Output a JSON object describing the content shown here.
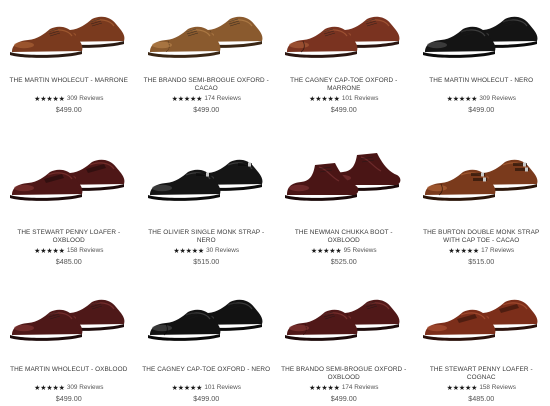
{
  "products": [
    {
      "name": "THE MARTIN WHOLECUT - MARRONE",
      "stars": "★★★★★",
      "reviews": "309 Reviews",
      "price": "$499.00",
      "style": "wholecut",
      "color": "#7a3a1e",
      "highlight": "#b46a3a",
      "sole": "#2a1a12"
    },
    {
      "name": "THE BRANDO SEMI-BROGUE OXFORD - CACAO",
      "stars": "★★★★★",
      "reviews": "174 Reviews",
      "price": "$499.00",
      "style": "brogue",
      "color": "#8a5a2e",
      "highlight": "#c08a52",
      "sole": "#3a2614"
    },
    {
      "name": "THE CAGNEY CAP-TOE OXFORD - MARRONE",
      "stars": "★★★★★",
      "reviews": "101 Reviews",
      "price": "$499.00",
      "style": "captoe",
      "color": "#7a3320",
      "highlight": "#b2643e",
      "sole": "#2a1510"
    },
    {
      "name": "THE MARTIN WHOLECUT - NERO",
      "stars": "★★★★★",
      "reviews": "309 Reviews",
      "price": "$499.00",
      "style": "wholecut",
      "color": "#141414",
      "highlight": "#5a5a5a",
      "sole": "#0a0a0a"
    },
    {
      "name": "THE STEWART PENNY LOAFER - OXBLOOD",
      "stars": "★★★★★",
      "reviews": "158 Reviews",
      "price": "$485.00",
      "style": "loafer",
      "color": "#4e1717",
      "highlight": "#8a3a36",
      "sole": "#1c0a0a"
    },
    {
      "name": "THE OLIVIER SINGLE MONK STRAP - NERO",
      "stars": "★★★★★",
      "reviews": "30 Reviews",
      "price": "$515.00",
      "style": "monk",
      "color": "#151515",
      "highlight": "#555555",
      "sole": "#0a0a0a"
    },
    {
      "name": "THE NEWMAN CHUKKA BOOT - OXBLOOD",
      "stars": "★★★★★",
      "reviews": "95 Reviews",
      "price": "$525.00",
      "style": "chukka",
      "color": "#4a1515",
      "highlight": "#86393a",
      "sole": "#1a0909"
    },
    {
      "name": "THE BURTON DOUBLE MONK STRAP WITH CAP TOE - CACAO",
      "stars": "★★★★★",
      "reviews": "17 Reviews",
      "price": "$515.00",
      "style": "doublemonk",
      "color": "#7a3a1c",
      "highlight": "#b86a3c",
      "sole": "#2a1408"
    },
    {
      "name": "THE MARTIN WHOLECUT - OXBLOOD",
      "stars": "★★★★★",
      "reviews": "309 Reviews",
      "price": "$499.00",
      "style": "wholecut",
      "color": "#4e1818",
      "highlight": "#8c3c3a",
      "sole": "#1c0a0a"
    },
    {
      "name": "THE CAGNEY CAP-TOE OXFORD - NERO",
      "stars": "★★★★★",
      "reviews": "101 Reviews",
      "price": "$499.00",
      "style": "captoe",
      "color": "#121212",
      "highlight": "#555555",
      "sole": "#080808"
    },
    {
      "name": "THE BRANDO SEMI-BROGUE OXFORD - OXBLOOD",
      "stars": "★★★★★",
      "reviews": "174 Reviews",
      "price": "$499.00",
      "style": "brogue",
      "color": "#501818",
      "highlight": "#8e3e3a",
      "sole": "#1c0a0a"
    },
    {
      "name": "THE STEWART PENNY LOAFER - COGNAC",
      "stars": "★★★★★",
      "reviews": "158 Reviews",
      "price": "$485.00",
      "style": "loafer",
      "color": "#7c2e1a",
      "highlight": "#b45a3a",
      "sole": "#2a100a"
    }
  ]
}
